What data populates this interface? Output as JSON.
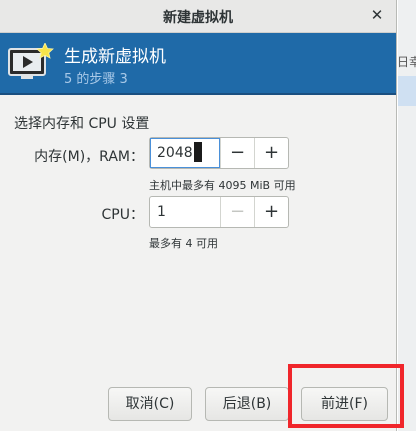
{
  "window": {
    "title": "新建虚拟机"
  },
  "banner": {
    "heading": "生成新虚拟机",
    "step": "5 的步骤 3"
  },
  "section": {
    "title": "选择内存和 CPU 设置"
  },
  "memory": {
    "label": "内存(M)，RAM：",
    "value": "2048",
    "decrement": "−",
    "increment": "+",
    "hint": "主机中最多有 4095 MiB 可用"
  },
  "cpu": {
    "label": "CPU：",
    "value": "1",
    "decrement": "−",
    "increment": "+",
    "hint": "最多有 4 可用"
  },
  "footer": {
    "cancel": "取消(C)",
    "back": "后退(B)",
    "forward": "前进(F)"
  },
  "background_window": {
    "fragment": "日幸"
  },
  "colors": {
    "banner": "#1f6aa8",
    "highlight": "#f0262b"
  }
}
